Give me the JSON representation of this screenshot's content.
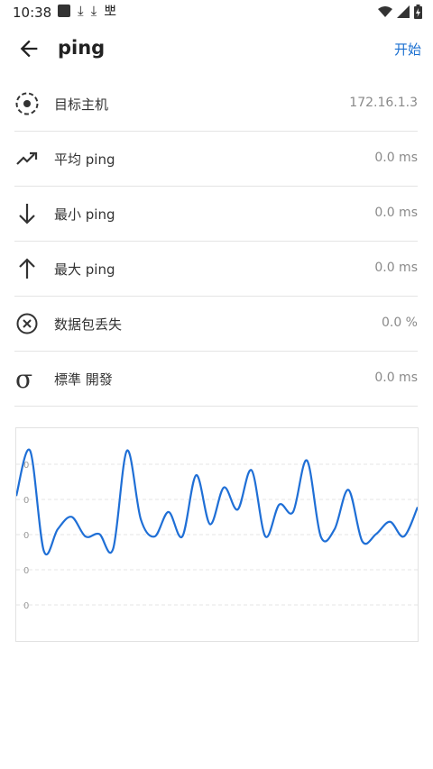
{
  "status_bar": {
    "time": "10:38",
    "left_icons": [
      "app-icon",
      "download-icon",
      "download-icon",
      "notification-icon"
    ],
    "right_icons": [
      "wifi-icon",
      "signal-icon",
      "battery-icon"
    ],
    "notification_glyph": "뽀"
  },
  "app_bar": {
    "title": "ping",
    "action_label": "开始"
  },
  "rows": [
    {
      "icon": "target-icon",
      "label": "目标主机",
      "value": "172.16.1.3"
    },
    {
      "icon": "trending-up-icon",
      "label": "平均 ping",
      "value": "0.0 ms"
    },
    {
      "icon": "arrow-down-icon",
      "label": "最小 ping",
      "value": "0.0 ms"
    },
    {
      "icon": "arrow-up-icon",
      "label": "最大 ping",
      "value": "0.0 ms"
    },
    {
      "icon": "cancel-circle-icon",
      "label": "数据包丢失",
      "value": "0.0 %"
    },
    {
      "icon": "sigma-icon",
      "label": "標準 開發",
      "value": "0.0 ms"
    }
  ],
  "chart_data": {
    "type": "line",
    "y_tick_labels": [
      "0",
      "0",
      "0",
      "0",
      "0"
    ],
    "grid": true,
    "line_color": "#1f6fd6",
    "series": [
      {
        "values": [
          0.55,
          0.92,
          0.1,
          0.28,
          0.38,
          0.22,
          0.24,
          0.12,
          0.92,
          0.36,
          0.22,
          0.42,
          0.22,
          0.72,
          0.32,
          0.62,
          0.44,
          0.76,
          0.22,
          0.48,
          0.42,
          0.84,
          0.22,
          0.28,
          0.6,
          0.18,
          0.24,
          0.34,
          0.22,
          0.46
        ]
      }
    ]
  }
}
